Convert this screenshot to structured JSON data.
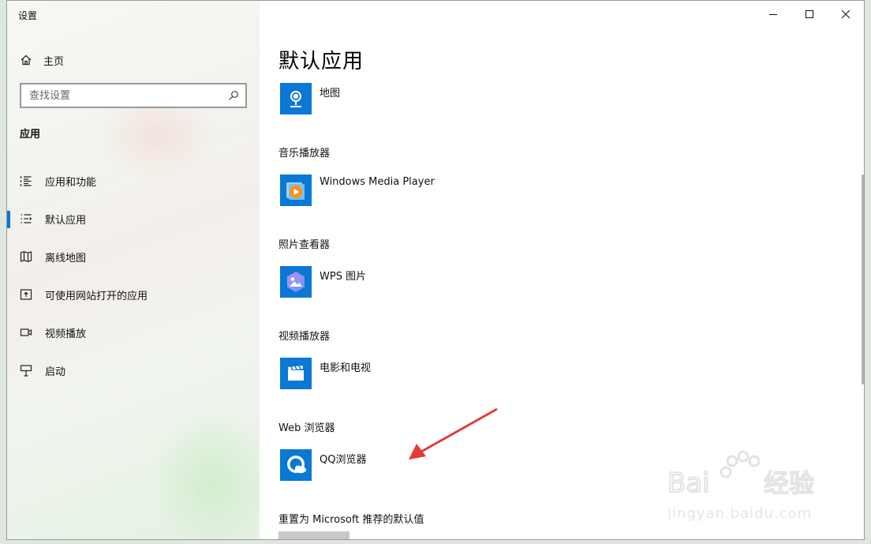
{
  "window": {
    "title": "设置"
  },
  "sidebar": {
    "home_label": "主页",
    "search_placeholder": "查找设置",
    "section_title": "应用",
    "items": [
      {
        "label": "应用和功能",
        "icon": "list-icon",
        "active": false
      },
      {
        "label": "默认应用",
        "icon": "default-apps-icon",
        "active": true
      },
      {
        "label": "离线地图",
        "icon": "map-icon",
        "active": false
      },
      {
        "label": "可使用网站打开的应用",
        "icon": "open-in-app-icon",
        "active": false
      },
      {
        "label": "视频播放",
        "icon": "video-icon",
        "active": false
      },
      {
        "label": "启动",
        "icon": "startup-icon",
        "active": false
      }
    ]
  },
  "main": {
    "title": "默认应用",
    "entries": [
      {
        "category": "",
        "app": "地图",
        "icon": "maps-app-icon"
      },
      {
        "category": "音乐播放器",
        "app": "Windows Media Player",
        "icon": "wmp-icon"
      },
      {
        "category": "照片查看器",
        "app": "WPS 图片",
        "icon": "wps-picture-icon"
      },
      {
        "category": "视频播放器",
        "app": "电影和电视",
        "icon": "movies-tv-icon"
      },
      {
        "category": "Web 浏览器",
        "app": "QQ浏览器",
        "icon": "qq-browser-icon"
      }
    ],
    "reset_label": "重置为 Microsoft 推荐的默认值"
  },
  "watermark": {
    "text": "jingyan.baidu.com"
  },
  "colors": {
    "accent": "#0078d7",
    "tile": "#0a78d4",
    "arrow": "#e53935"
  }
}
